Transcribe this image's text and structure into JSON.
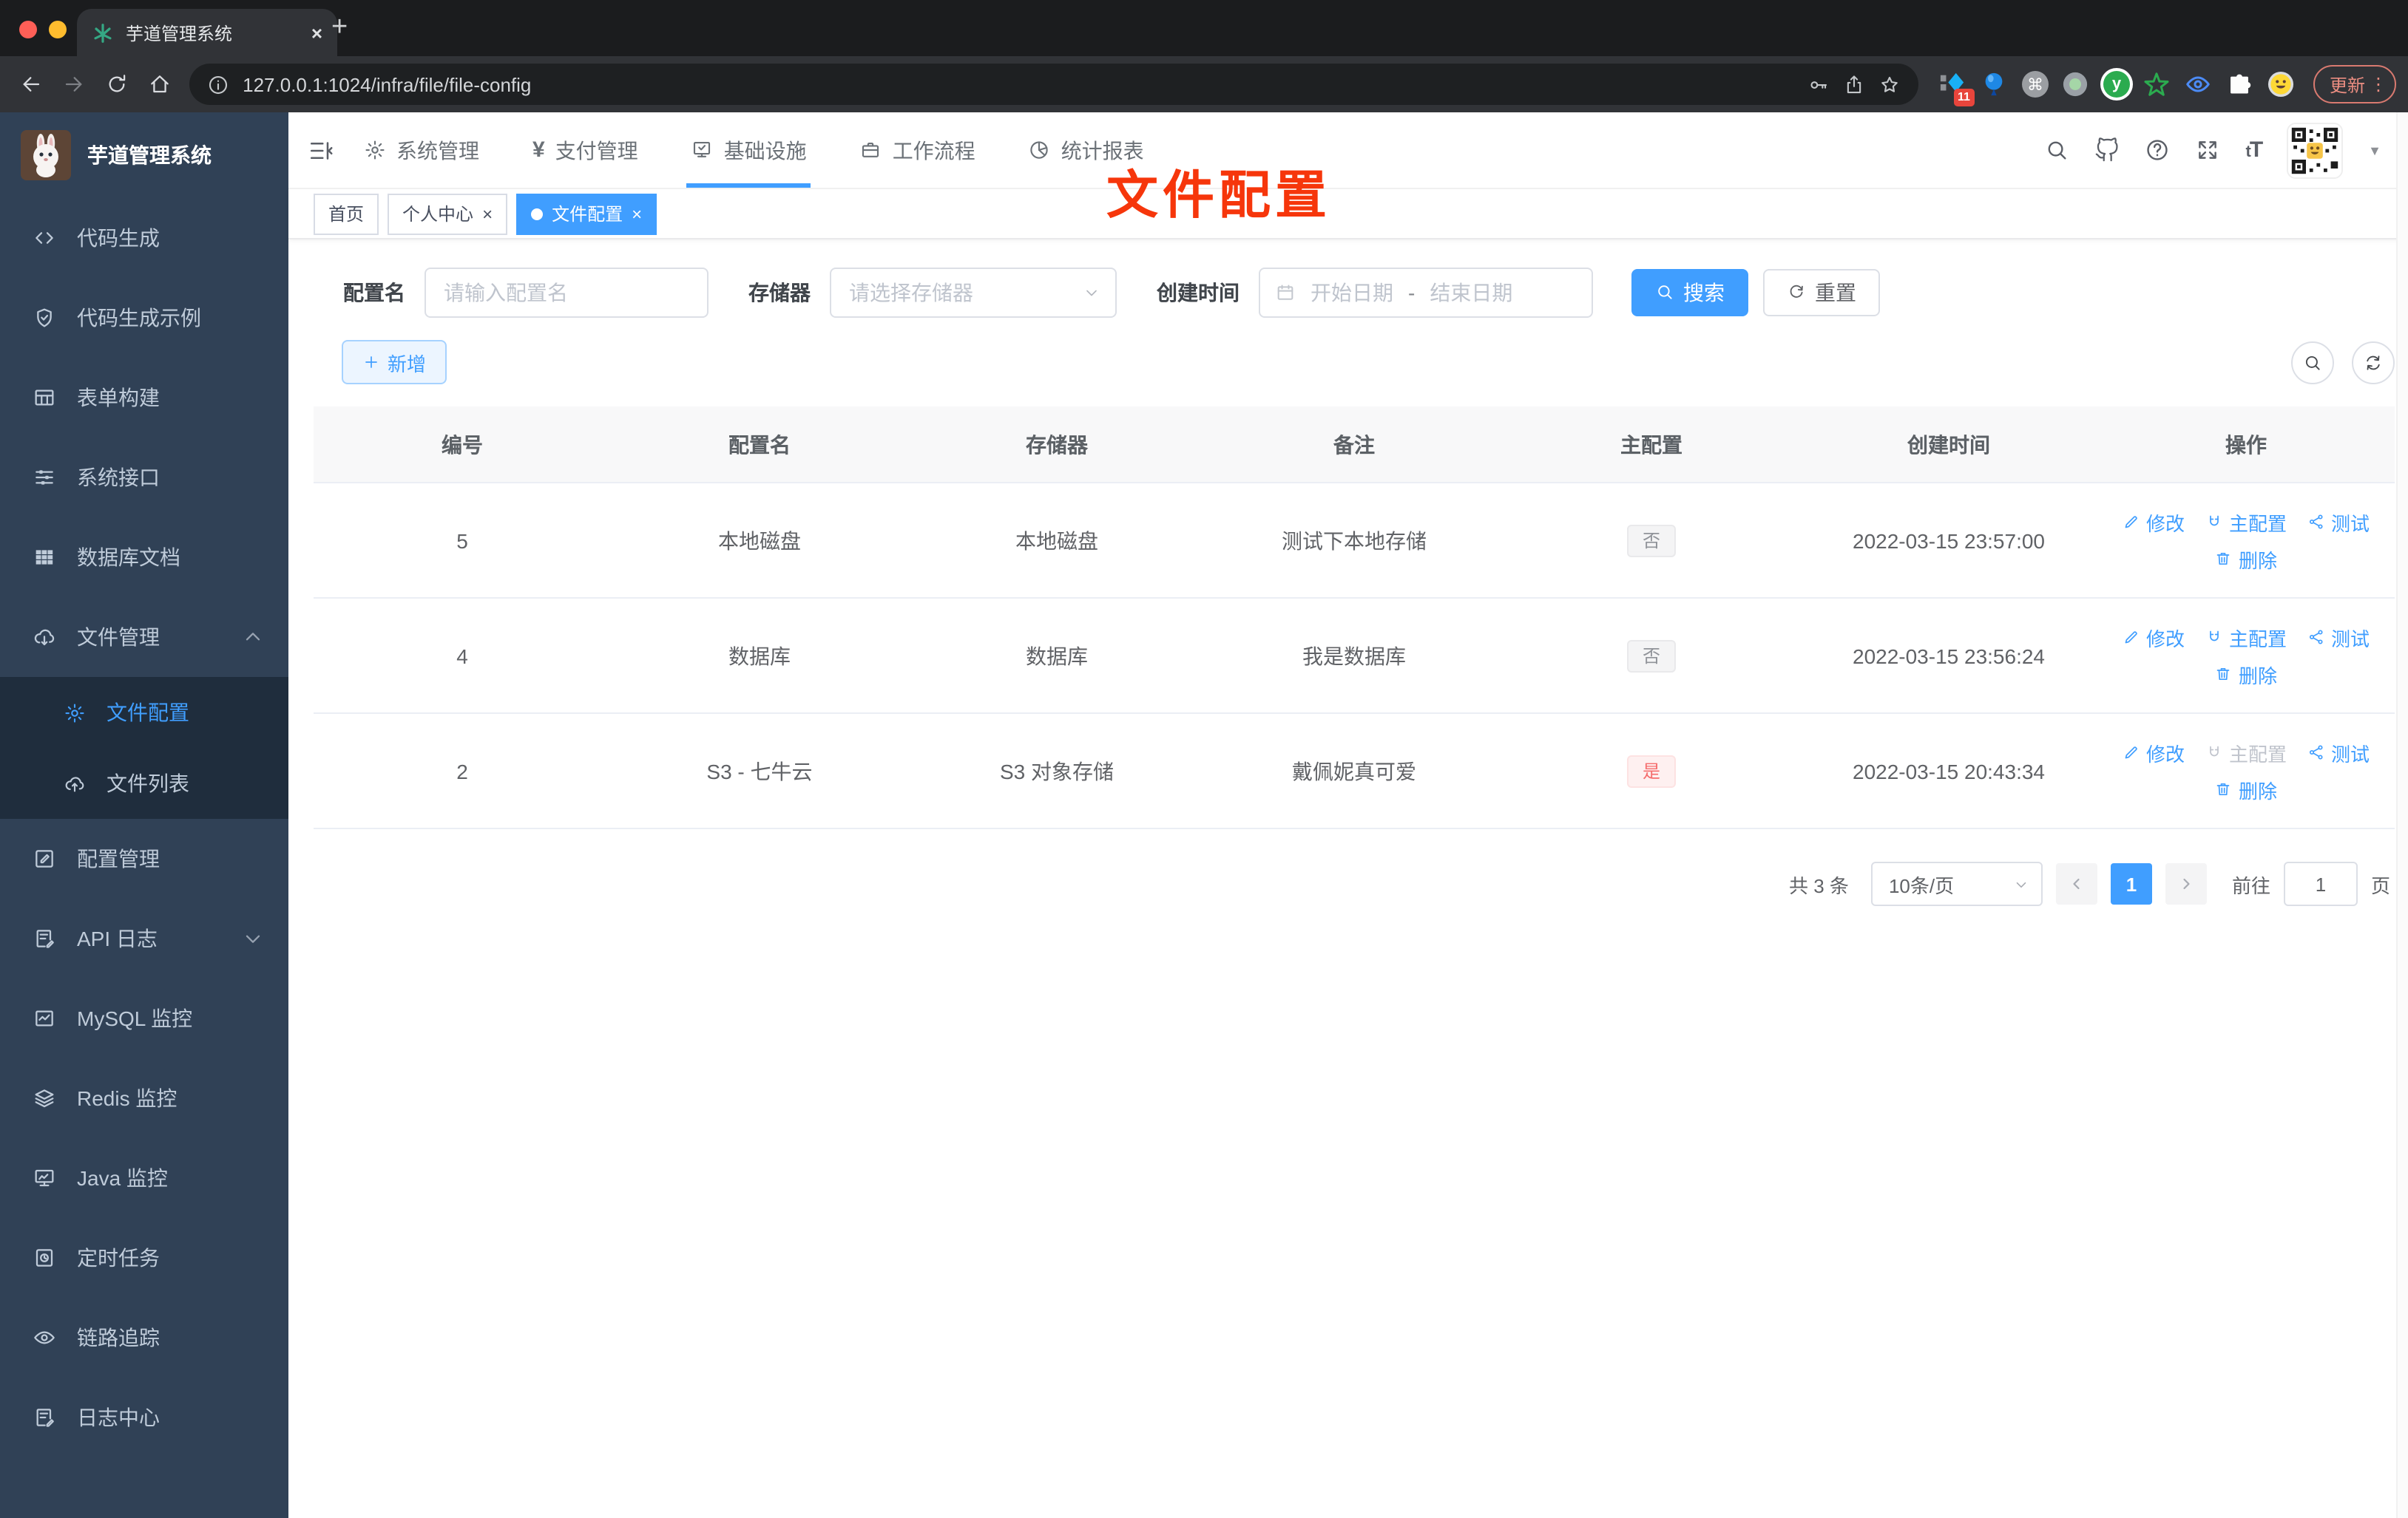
{
  "colors": {
    "primary": "#409eff",
    "sidebar_bg": "#304156",
    "submenu_bg": "#1f2d3d",
    "overlay_red": "#f6360b",
    "tag_info_text": "#909399",
    "tag_danger_text": "#f56c6c"
  },
  "glyphs": {
    "close_glyph": "×",
    "plus_glyph": "+",
    "dots_glyph": "⋮",
    "cmd_glyph": "⌘",
    "caret_glyph": "▼",
    "yen_glyph": "¥",
    "font_size_glyph_small": "t",
    "font_size_glyph_big": "T"
  },
  "browser": {
    "tab_title": "芋道管理系统",
    "url": "127.0.0.1:1024/infra/file/file-config",
    "update_label": "更新",
    "extension_badge": "11"
  },
  "header": {
    "nav": [
      {
        "label": "系统管理",
        "icon": "gear"
      },
      {
        "label": "支付管理",
        "icon": "yen"
      },
      {
        "label": "基础设施",
        "icon": "infra",
        "active": true
      },
      {
        "label": "工作流程",
        "icon": "briefcase"
      },
      {
        "label": "统计报表",
        "icon": "stats"
      }
    ]
  },
  "tabs": [
    {
      "label": "首页",
      "closable": false,
      "active": false
    },
    {
      "label": "个人中心",
      "closable": true,
      "active": false
    },
    {
      "label": "文件配置",
      "closable": true,
      "active": true
    }
  ],
  "overlay_title": "文件配置",
  "sidebar": {
    "title": "芋道管理系统",
    "items": [
      {
        "label": "代码生成",
        "icon": "code"
      },
      {
        "label": "代码生成示例",
        "icon": "shield"
      },
      {
        "label": "表单构建",
        "icon": "table"
      },
      {
        "label": "系统接口",
        "icon": "sliders"
      },
      {
        "label": "数据库文档",
        "icon": "grid"
      },
      {
        "label": "文件管理",
        "icon": "cloud-down",
        "expanded": true,
        "children": [
          {
            "label": "文件配置",
            "icon": "gear",
            "active": true
          },
          {
            "label": "文件列表",
            "icon": "cloud-up"
          }
        ]
      },
      {
        "label": "配置管理",
        "icon": "edit-square"
      },
      {
        "label": "API 日志",
        "icon": "doc-edit",
        "collapsed": true
      },
      {
        "label": "MySQL 监控",
        "icon": "chart"
      },
      {
        "label": "Redis 监控",
        "icon": "layers"
      },
      {
        "label": "Java 监控",
        "icon": "monitor"
      },
      {
        "label": "定时任务",
        "icon": "clock"
      },
      {
        "label": "链路追踪",
        "icon": "eye"
      },
      {
        "label": "日志中心",
        "icon": "doc-edit"
      }
    ]
  },
  "filters": {
    "name_label": "配置名",
    "name_placeholder": "请输入配置名",
    "storage_label": "存储器",
    "storage_placeholder": "请选择存储器",
    "date_label": "创建时间",
    "date_start_placeholder": "开始日期",
    "date_separator": "-",
    "date_end_placeholder": "结束日期",
    "search_label": "搜索",
    "reset_label": "重置",
    "add_label": "新增"
  },
  "table": {
    "headers": [
      "编号",
      "配置名",
      "存储器",
      "备注",
      "主配置",
      "创建时间",
      "操作"
    ],
    "action_labels": {
      "edit": "修改",
      "master": "主配置",
      "test": "测试",
      "delete": "删除"
    },
    "rows": [
      {
        "id": "5",
        "name": "本地磁盘",
        "storage": "本地磁盘",
        "remark": "测试下本地存储",
        "master": "否",
        "master_type": "info",
        "created": "2022-03-15 23:57:00",
        "master_action_disabled": false
      },
      {
        "id": "4",
        "name": "数据库",
        "storage": "数据库",
        "remark": "我是数据库",
        "master": "否",
        "master_type": "info",
        "created": "2022-03-15 23:56:24",
        "master_action_disabled": false
      },
      {
        "id": "2",
        "name": "S3 - 七牛云",
        "storage": "S3 对象存储",
        "remark": "戴佩妮真可爱",
        "master": "是",
        "master_type": "danger",
        "created": "2022-03-15 20:43:34",
        "master_action_disabled": true
      }
    ]
  },
  "pagination": {
    "total": "共 3 条",
    "page_size": "10条/页",
    "current_page": "1",
    "goto_label": "前往",
    "goto_value": "1",
    "page_suffix": "页"
  }
}
